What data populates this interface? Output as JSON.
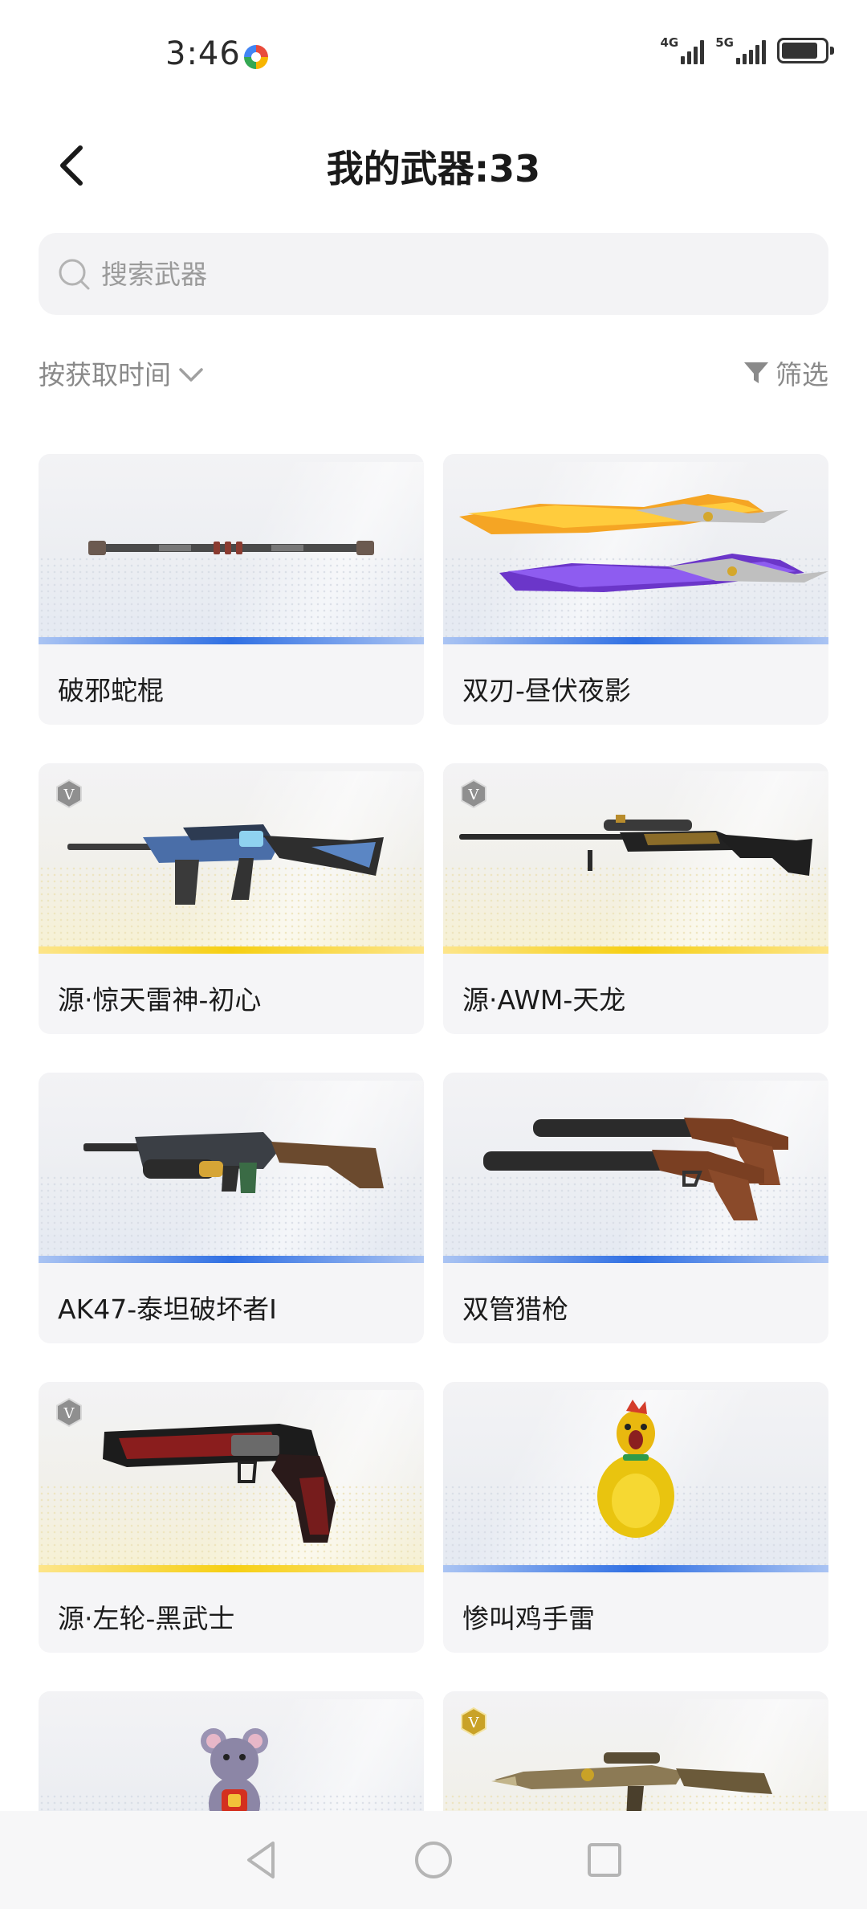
{
  "status_bar": {
    "time": "3:46",
    "network_1": "4G",
    "network_2": "5G",
    "app_icon": "colorful-app-icon",
    "battery_icon": "battery-icon"
  },
  "header": {
    "title": "我的武器:33",
    "back_icon": "back-arrow-icon"
  },
  "search": {
    "placeholder": "搜索武器",
    "value": "",
    "icon": "search-icon"
  },
  "toolbar": {
    "sort_label": "按获取时间",
    "sort_icon": "chevron-down-icon",
    "filter_label": "筛选",
    "filter_icon": "filter-icon"
  },
  "weapons": [
    {
      "name": "破邪蛇棍",
      "rarity": "blue",
      "badge": "",
      "art": "staff-weapon"
    },
    {
      "name": "双刃-昼伏夜影",
      "rarity": "blue",
      "badge": "",
      "art": "dual-blades"
    },
    {
      "name": "源·惊天雷神-初心",
      "rarity": "gold",
      "badge": "V",
      "art": "assault-rifle"
    },
    {
      "name": "源·AWM-天龙",
      "rarity": "gold",
      "badge": "V",
      "art": "sniper-rifle"
    },
    {
      "name": "AK47-泰坦破坏者I",
      "rarity": "blue",
      "badge": "",
      "art": "machine-gun"
    },
    {
      "name": "双管猎枪",
      "rarity": "blue",
      "badge": "",
      "art": "double-barrel-shotgun"
    },
    {
      "name": "源·左轮-黑武士",
      "rarity": "gold",
      "badge": "V",
      "art": "revolver"
    },
    {
      "name": "惨叫鸡手雷",
      "rarity": "blue",
      "badge": "",
      "art": "chicken-grenade"
    },
    {
      "name": "",
      "rarity": "blue",
      "badge": "",
      "art": "mouse-grenade"
    },
    {
      "name": "",
      "rarity": "gold",
      "badge": "V",
      "art": "ornate-rifle"
    }
  ],
  "colors": {
    "rarity_blue": "#2f6fe3",
    "rarity_gold": "#f6cf12",
    "card_bg": "#f5f5f7",
    "search_bg": "#f3f3f5"
  },
  "nav": {
    "back_icon": "nav-back-icon",
    "home_icon": "nav-home-icon",
    "recents_icon": "nav-recents-icon"
  }
}
